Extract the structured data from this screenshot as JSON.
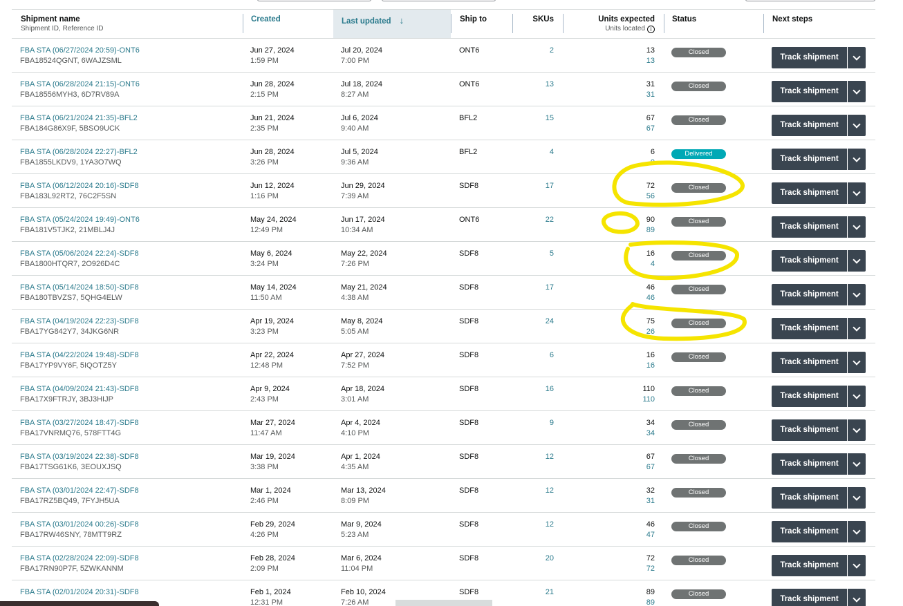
{
  "columns": {
    "shipment_name": "Shipment name",
    "shipment_name_sub": "Shipment ID, Reference ID",
    "created": "Created",
    "last_updated": "Last updated",
    "ship_to": "Ship to",
    "skus": "SKUs",
    "units_expected": "Units expected",
    "units_located": "Units located",
    "status": "Status",
    "next_steps": "Next steps"
  },
  "sort_icon": "arrow-down-icon",
  "track_label": "Track shipment",
  "rows": [
    {
      "name": "FBA STA (06/27/2024 20:59)-ONT6",
      "ids": "FBA18524QGNT, 6WAJZSML",
      "created_date": "Jun 27, 2024",
      "created_time": "1:59 PM",
      "updated_date": "Jul 20, 2024",
      "updated_time": "7:00 PM",
      "ship_to": "ONT6",
      "skus": "2",
      "expected": "13",
      "located": "13",
      "status": "Closed"
    },
    {
      "name": "FBA STA (06/28/2024 21:15)-ONT6",
      "ids": "FBA18556MYH3, 6D7RV89A",
      "created_date": "Jun 28, 2024",
      "created_time": "2:15 PM",
      "updated_date": "Jul 18, 2024",
      "updated_time": "8:27 AM",
      "ship_to": "ONT6",
      "skus": "13",
      "expected": "31",
      "located": "31",
      "status": "Closed"
    },
    {
      "name": "FBA STA (06/21/2024 21:35)-BFL2",
      "ids": "FBA184G86X9F, 5BSO9UCK",
      "created_date": "Jun 21, 2024",
      "created_time": "2:35 PM",
      "updated_date": "Jul 6, 2024",
      "updated_time": "9:40 AM",
      "ship_to": "BFL2",
      "skus": "15",
      "expected": "67",
      "located": "67",
      "status": "Closed"
    },
    {
      "name": "FBA STA (06/28/2024 22:27)-BFL2",
      "ids": "FBA1855LKDV9, 1YA3O7WQ",
      "created_date": "Jun 28, 2024",
      "created_time": "3:26 PM",
      "updated_date": "Jul 5, 2024",
      "updated_time": "9:36 AM",
      "ship_to": "BFL2",
      "skus": "4",
      "expected": "6",
      "located": "0",
      "status": "Delivered"
    },
    {
      "name": "FBA STA (06/12/2024 20:16)-SDF8",
      "ids": "FBA183L92RT2, 76C2F5SN",
      "created_date": "Jun 12, 2024",
      "created_time": "1:16 PM",
      "updated_date": "Jun 29, 2024",
      "updated_time": "7:39 AM",
      "ship_to": "SDF8",
      "skus": "17",
      "expected": "72",
      "located": "56",
      "status": "Closed"
    },
    {
      "name": "FBA STA (05/24/2024 19:49)-ONT6",
      "ids": "FBA181V5TJK2, 21MBLJ4J",
      "created_date": "May 24, 2024",
      "created_time": "12:49 PM",
      "updated_date": "Jun 17, 2024",
      "updated_time": "10:34 AM",
      "ship_to": "ONT6",
      "skus": "22",
      "expected": "90",
      "located": "89",
      "status": "Closed"
    },
    {
      "name": "FBA STA (05/06/2024 22:24)-SDF8",
      "ids": "FBA1800HTQR7, 2O926D4C",
      "created_date": "May 6, 2024",
      "created_time": "3:24 PM",
      "updated_date": "May 22, 2024",
      "updated_time": "7:26 PM",
      "ship_to": "SDF8",
      "skus": "5",
      "expected": "16",
      "located": "4",
      "status": "Closed"
    },
    {
      "name": "FBA STA (05/14/2024 18:50)-SDF8",
      "ids": "FBA180TBVZS7, 5QHG4ELW",
      "created_date": "May 14, 2024",
      "created_time": "11:50 AM",
      "updated_date": "May 21, 2024",
      "updated_time": "4:38 AM",
      "ship_to": "SDF8",
      "skus": "17",
      "expected": "46",
      "located": "46",
      "status": "Closed"
    },
    {
      "name": "FBA STA (04/19/2024 22:23)-SDF8",
      "ids": "FBA17YG842Y7, 34JKG6NR",
      "created_date": "Apr 19, 2024",
      "created_time": "3:23 PM",
      "updated_date": "May 8, 2024",
      "updated_time": "5:05 AM",
      "ship_to": "SDF8",
      "skus": "24",
      "expected": "75",
      "located": "26",
      "status": "Closed"
    },
    {
      "name": "FBA STA (04/22/2024 19:48)-SDF8",
      "ids": "FBA17YP9VY6F, 5IQOTZ5Y",
      "created_date": "Apr 22, 2024",
      "created_time": "12:48 PM",
      "updated_date": "Apr 27, 2024",
      "updated_time": "7:52 PM",
      "ship_to": "SDF8",
      "skus": "6",
      "expected": "16",
      "located": "16",
      "status": "Closed"
    },
    {
      "name": "FBA STA (04/09/2024 21:43)-SDF8",
      "ids": "FBA17X9FTRJY, 3BJ3HIJP",
      "created_date": "Apr 9, 2024",
      "created_time": "2:43 PM",
      "updated_date": "Apr 18, 2024",
      "updated_time": "3:01 AM",
      "ship_to": "SDF8",
      "skus": "16",
      "expected": "110",
      "located": "110",
      "status": "Closed"
    },
    {
      "name": "FBA STA (03/27/2024 18:47)-SDF8",
      "ids": "FBA17VNRMQ76, 578FTT4G",
      "created_date": "Mar 27, 2024",
      "created_time": "11:47 AM",
      "updated_date": "Apr 4, 2024",
      "updated_time": "4:10 PM",
      "ship_to": "SDF8",
      "skus": "9",
      "expected": "34",
      "located": "34",
      "status": "Closed"
    },
    {
      "name": "FBA STA (03/19/2024 22:38)-SDF8",
      "ids": "FBA17TSG61K6, 3EOUXJSQ",
      "created_date": "Mar 19, 2024",
      "created_time": "3:38 PM",
      "updated_date": "Apr 1, 2024",
      "updated_time": "4:35 AM",
      "ship_to": "SDF8",
      "skus": "12",
      "expected": "67",
      "located": "67",
      "status": "Closed"
    },
    {
      "name": "FBA STA (03/01/2024 22:47)-SDF8",
      "ids": "FBA17RZ5BQ49, 7FYJH5UA",
      "created_date": "Mar 1, 2024",
      "created_time": "2:46 PM",
      "updated_date": "Mar 13, 2024",
      "updated_time": "8:09 PM",
      "ship_to": "SDF8",
      "skus": "12",
      "expected": "32",
      "located": "31",
      "status": "Closed"
    },
    {
      "name": "FBA STA (03/01/2024 00:26)-SDF8",
      "ids": "FBA17RW46SNY, 78MTT9RZ",
      "created_date": "Feb 29, 2024",
      "created_time": "4:26 PM",
      "updated_date": "Mar 9, 2024",
      "updated_time": "5:23 AM",
      "ship_to": "SDF8",
      "skus": "12",
      "expected": "46",
      "located": "47",
      "status": "Closed"
    },
    {
      "name": "FBA STA (02/28/2024 22:09)-SDF8",
      "ids": "FBA17RN90P7F, 5ZWKANNM",
      "created_date": "Feb 28, 2024",
      "created_time": "2:09 PM",
      "updated_date": "Mar 6, 2024",
      "updated_time": "11:04 PM",
      "ship_to": "SDF8",
      "skus": "20",
      "expected": "72",
      "located": "72",
      "status": "Closed"
    },
    {
      "name": "FBA STA (02/01/2024 20:31)-SDF8",
      "ids": "",
      "created_date": "Feb 1, 2024",
      "created_time": "12:31 PM",
      "updated_date": "Feb 10, 2024",
      "updated_time": "7:26 AM",
      "ship_to": "SDF8",
      "skus": "21",
      "expected": "89",
      "located": "89",
      "status": "Closed"
    }
  ],
  "colors": {
    "link": "#2a7a8c",
    "button": "#3a4550",
    "badge_closed": "#6f7373",
    "badge_delivered": "#00a8b5",
    "highlight": "#f5e400"
  }
}
